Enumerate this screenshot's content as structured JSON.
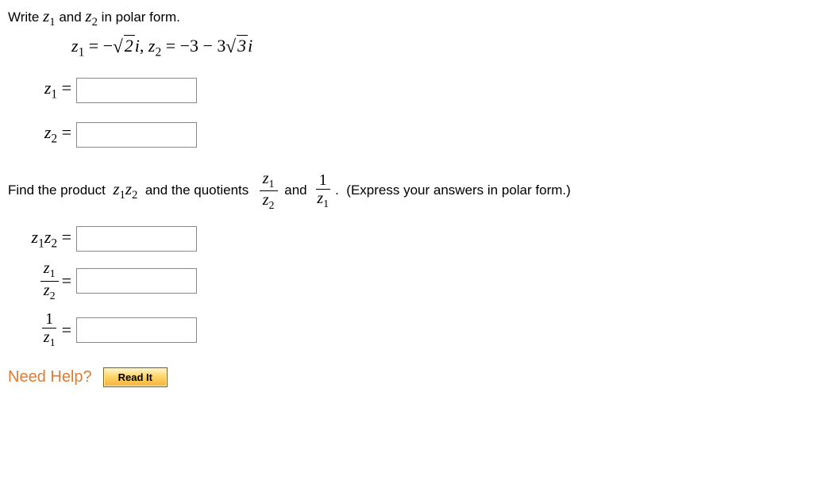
{
  "prompt1_prefix": "Write ",
  "z1_name": "z",
  "z1_sub": "1",
  "prompt1_mid": " and ",
  "z2_name": "z",
  "z2_sub": "2",
  "prompt1_suffix": "  in polar form.",
  "given": {
    "z1_lhs_a": "z",
    "z1_lhs_sub": "1",
    "eq": " = ",
    "z1_rhs_neg": "−",
    "z1_rhs_rad": "2",
    "z1_rhs_i": "i",
    "comma": ",  ",
    "z2_lhs_a": "z",
    "z2_lhs_sub": "2",
    "z2_rhs_a": " = −3 − 3",
    "z2_rhs_rad": "3",
    "z2_rhs_i": "i"
  },
  "labels": {
    "z1eq_a": "z",
    "z1eq_sub": "1",
    "z1eq_eq": " = ",
    "z2eq_a": "z",
    "z2eq_sub": "2",
    "z2eq_eq": " = ",
    "z1z2_a": "z",
    "z1z2_s1": "1",
    "z1z2_b": "z",
    "z1z2_s2": "2",
    "z1z2_eq": " = ",
    "frac1_num_a": "z",
    "frac1_num_s": "1",
    "frac1_den_a": "z",
    "frac1_den_s": "2",
    "frac2_num": "1",
    "frac2_den_a": "z",
    "frac2_den_s": "1",
    "frac_eq": " = "
  },
  "prompt2": {
    "a": "Find the product  ",
    "prod_a": "z",
    "prod_s1": "1",
    "prod_b": "z",
    "prod_s2": "2",
    "b": "  and the quotients  ",
    "and": " and ",
    "period": ".  ",
    "hint": "(Express your answers in polar form.)"
  },
  "help": {
    "label": "Need Help?",
    "button": "Read It"
  },
  "inputs": {
    "z1": "",
    "z2": "",
    "z1z2": "",
    "z1_over_z2": "",
    "one_over_z1": ""
  }
}
